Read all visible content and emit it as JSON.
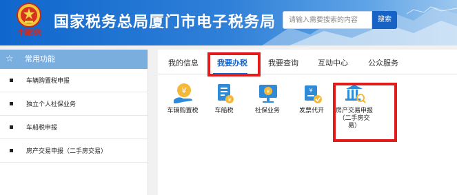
{
  "header": {
    "title": "国家税务总局厦门市电子税务局",
    "motto": "中國稅務",
    "search_placeholder": "请输入需要搜索的内容",
    "search_button": "搜索"
  },
  "sidebar": {
    "header": "常用功能",
    "items": [
      {
        "label": "车辆购置税申报"
      },
      {
        "label": "独立个人社保业务"
      },
      {
        "label": "车船税申报"
      },
      {
        "label": "房产交易申报（二手房交易）"
      }
    ]
  },
  "tabs": [
    {
      "label": "我的信息",
      "active": false
    },
    {
      "label": "我要办税",
      "active": true
    },
    {
      "label": "我要查询",
      "active": false
    },
    {
      "label": "互动中心",
      "active": false
    },
    {
      "label": "公众服务",
      "active": false
    }
  ],
  "services": [
    {
      "label": "车辆购置税",
      "icon": "coin-hand-icon"
    },
    {
      "label": "车船税",
      "icon": "document-coin-icon"
    },
    {
      "label": "社保业务",
      "icon": "monitor-coin-icon"
    },
    {
      "label": "发票代开",
      "icon": "invoice-check-icon"
    },
    {
      "label": "房产交易申报（二手房交易）",
      "label_lines": [
        "房产交易申报",
        "（二手房交",
        "易）"
      ],
      "icon": "building-search-icon"
    }
  ],
  "colors": {
    "header_blue": "#1763c5",
    "active_tab": "#1a66c8",
    "highlight_red": "#e21b1b",
    "sidebar_header": "#7aaedf"
  }
}
